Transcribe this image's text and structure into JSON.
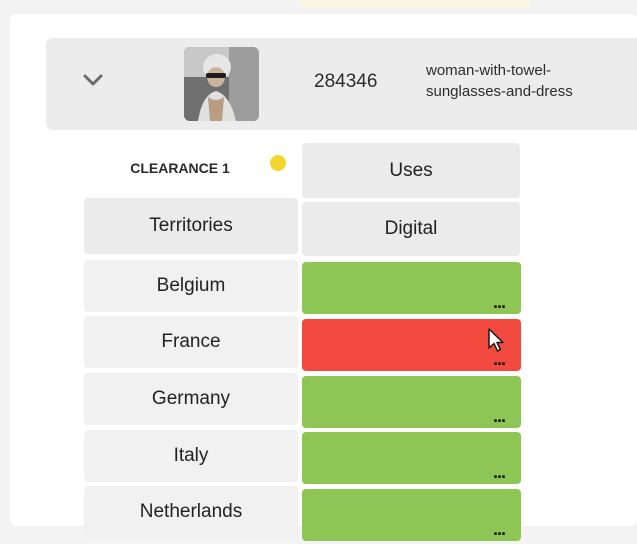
{
  "asset": {
    "id": "284346",
    "name": "woman-with-towel-sunglasses-and-dress"
  },
  "clearance": {
    "label": "CLEARANCE 1",
    "indicator_color": "#f4d52e"
  },
  "table": {
    "uses_header": "Uses",
    "territories_header": "Territories",
    "use_column": "Digital",
    "rows": [
      {
        "territory": "Belgium",
        "status_color": "#8ec655",
        "more": "..."
      },
      {
        "territory": "France",
        "status_color": "#f34a3f",
        "more": "..."
      },
      {
        "territory": "Germany",
        "status_color": "#8ec655",
        "more": "..."
      },
      {
        "territory": "Italy",
        "status_color": "#8ec655",
        "more": "..."
      },
      {
        "territory": "Netherlands",
        "status_color": "#8ec655",
        "more": "..."
      }
    ]
  },
  "icons": {
    "expand": "chevron-down-icon",
    "cursor": "mouse-pointer-icon"
  },
  "colors": {
    "cleared": "#8ec655",
    "not_cleared": "#f34a3f"
  }
}
